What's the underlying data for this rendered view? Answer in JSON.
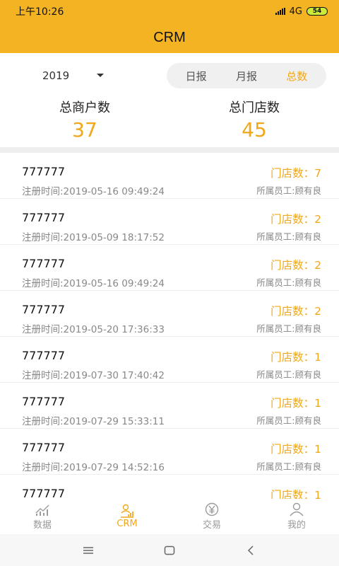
{
  "status_bar": {
    "time": "上午10:26",
    "network": "4G",
    "battery": "54"
  },
  "header": {
    "title": "CRM"
  },
  "filter": {
    "year": "2019",
    "tabs": [
      {
        "label": "日报",
        "active": false
      },
      {
        "label": "月报",
        "active": false
      },
      {
        "label": "总数",
        "active": true
      }
    ]
  },
  "totals": {
    "merchants_label": "总商户数",
    "merchants_value": "37",
    "stores_label": "总门店数",
    "stores_value": "45"
  },
  "merchants": [
    {
      "name": "777777",
      "time": "注册时间:2019-05-16 09:49:24",
      "stores": "门店数：7",
      "staff": "所属员工:顾有良"
    },
    {
      "name": "777777",
      "time": "注册时间:2019-05-09 18:17:52",
      "stores": "门店数：2",
      "staff": "所属员工:顾有良"
    },
    {
      "name": "777777",
      "time": "注册时间:2019-05-16 09:49:24",
      "stores": "门店数：2",
      "staff": "所属员工:顾有良"
    },
    {
      "name": "777777",
      "time": "注册时间:2019-05-20 17:36:33",
      "stores": "门店数：2",
      "staff": "所属员工:顾有良"
    },
    {
      "name": "777777",
      "time": "注册时间:2019-07-30 17:40:42",
      "stores": "门店数：1",
      "staff": "所属员工:顾有良"
    },
    {
      "name": "777777",
      "time": "注册时间:2019-07-29 15:33:11",
      "stores": "门店数：1",
      "staff": "所属员工:顾有良"
    },
    {
      "name": "777777",
      "time": "注册时间:2019-07-29 14:52:16",
      "stores": "门店数：1",
      "staff": "所属员工:顾有良"
    },
    {
      "name": "777777",
      "time": "",
      "stores": "门店数：1",
      "staff": ""
    }
  ],
  "tabbar": [
    {
      "label": "数据",
      "icon": "data-chart-icon",
      "active": false
    },
    {
      "label": "CRM",
      "icon": "crm-icon",
      "active": true
    },
    {
      "label": "交易",
      "icon": "yen-icon",
      "active": false
    },
    {
      "label": "我的",
      "icon": "person-icon",
      "active": false
    }
  ],
  "colors": {
    "brand": "#f3b322",
    "accent": "#f0a81b"
  }
}
